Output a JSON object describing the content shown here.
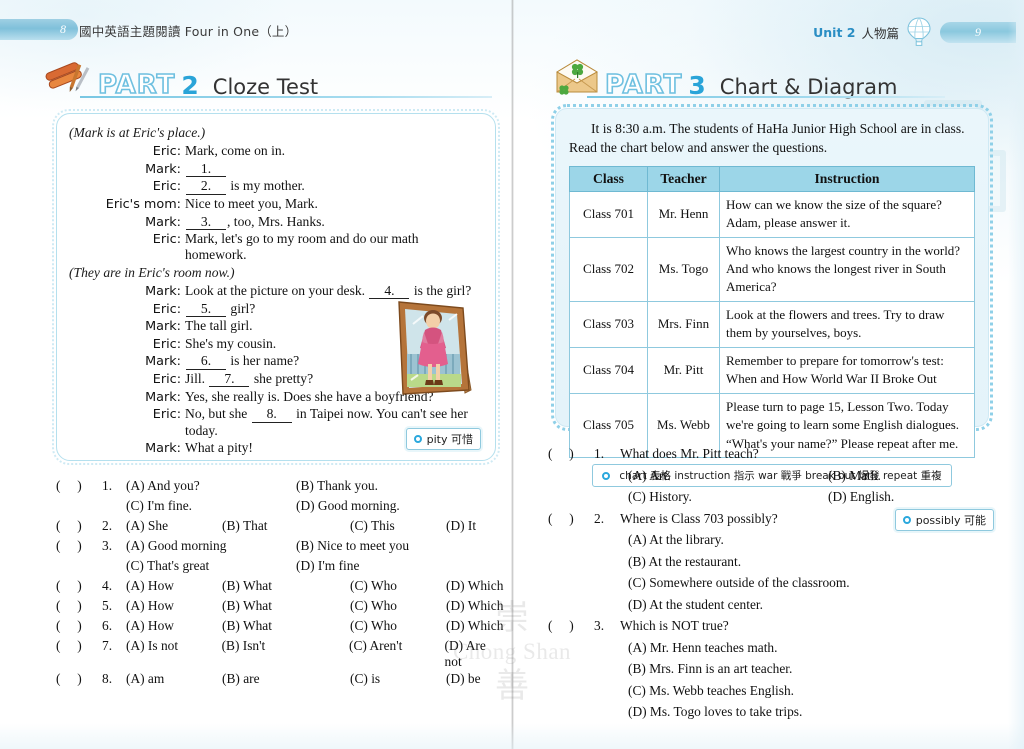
{
  "header": {
    "left_folio": "8",
    "left_title": "國中英語主題閱讀 Four in One（上）",
    "right_unit": "Unit 2",
    "right_unit_cjk": "人物篇",
    "right_folio": "9"
  },
  "part2": {
    "word": "PART",
    "number": "2",
    "title": "Cloze Test",
    "icon": "book-pencils-icon",
    "passage": {
      "stage_1": "(Mark is at Eric's place.)",
      "stage_2": "(They are in Eric's room now.)",
      "lines": [
        {
          "speaker": "Eric:",
          "before": "Mark, come on in.",
          "blank": "",
          "after": ""
        },
        {
          "speaker": "Mark:",
          "before": "",
          "blank": "1.",
          "after": ""
        },
        {
          "speaker": "Eric:",
          "before": "",
          "blank": "2.",
          "after": "is my mother."
        },
        {
          "speaker": "Eric's mom:",
          "before": "Nice to meet you, Mark.",
          "blank": "",
          "after": ""
        },
        {
          "speaker": "Mark:",
          "before": "",
          "blank": "3.",
          "after": ", too, Mrs. Hanks."
        },
        {
          "speaker": "Eric:",
          "before": "Mark, let's go to my room and do our math homework.",
          "blank": "",
          "after": ""
        },
        {
          "speaker": "Mark:",
          "before": "Look at the picture on your desk.",
          "blank": "4.",
          "after": "is the girl?"
        },
        {
          "speaker": "Eric:",
          "before": "",
          "blank": "5.",
          "after": "girl?"
        },
        {
          "speaker": "Mark:",
          "before": "The tall girl.",
          "blank": "",
          "after": ""
        },
        {
          "speaker": "Eric:",
          "before": "She's my cousin.",
          "blank": "",
          "after": ""
        },
        {
          "speaker": "Mark:",
          "before": "",
          "blank": "6.",
          "after": "is her name?"
        },
        {
          "speaker": "Eric:",
          "before": "Jill.",
          "blank": "7.",
          "after": "she pretty?"
        },
        {
          "speaker": "Mark:",
          "before": "Yes, she really is.  Does she have a boyfriend?",
          "blank": "",
          "after": ""
        },
        {
          "speaker": "Eric:",
          "before": "No, but she",
          "blank": "8.",
          "after": "in Taipei now.  You can't see her today."
        },
        {
          "speaker": "Mark:",
          "before": "What a pity!",
          "blank": "",
          "after": ""
        }
      ],
      "hint": "pity 可惜",
      "photo_alt": "framed-photo-woman-pink-dress"
    },
    "questions": [
      {
        "num": "1.",
        "layout": "two-line",
        "a": "(A) And you?",
        "b": "(B) Thank you.",
        "c": "(C) I'm fine.",
        "d": "(D) Good morning."
      },
      {
        "num": "2.",
        "layout": "one-line",
        "a": "(A) She",
        "b": "(B) That",
        "c": "(C) This",
        "d": "(D) It"
      },
      {
        "num": "3.",
        "layout": "two-line",
        "a": "(A) Good morning",
        "b": "(B) Nice to meet you",
        "c": "(C) That's great",
        "d": "(D) I'm fine"
      },
      {
        "num": "4.",
        "layout": "one-line",
        "a": "(A) How",
        "b": "(B) What",
        "c": "(C) Who",
        "d": "(D) Which"
      },
      {
        "num": "5.",
        "layout": "one-line",
        "a": "(A) How",
        "b": "(B) What",
        "c": "(C) Who",
        "d": "(D) Which"
      },
      {
        "num": "6.",
        "layout": "one-line",
        "a": "(A) How",
        "b": "(B) What",
        "c": "(C) Who",
        "d": "(D) Which"
      },
      {
        "num": "7.",
        "layout": "one-line",
        "a": "(A) Is not",
        "b": "(B) Isn't",
        "c": "(C) Aren't",
        "d": "(D) Are not"
      },
      {
        "num": "8.",
        "layout": "one-line",
        "a": "(A) am",
        "b": "(B) are",
        "c": "(C) is",
        "d": "(D) be"
      }
    ],
    "paren_open": "(",
    "paren_close": ")"
  },
  "part3": {
    "word": "PART",
    "number": "3",
    "title": "Chart & Diagram",
    "icon": "envelope-clover-icon",
    "intro_line_1": "It is 8:30 a.m.  The students of HaHa Junior High School are in class.",
    "intro_line_2": "Read the chart below and answer the questions.",
    "table": {
      "columns": [
        "Class",
        "Teacher",
        "Instruction"
      ],
      "rows": [
        {
          "class": "Class 701",
          "teacher": "Mr. Henn",
          "instruction": "How can we know the size of the square?  Adam, please answer it."
        },
        {
          "class": "Class 702",
          "teacher": "Ms. Togo",
          "instruction": "Who knows the largest country in the world?  And who knows the longest river in South America?"
        },
        {
          "class": "Class 703",
          "teacher": "Mrs. Finn",
          "instruction": "Look at the flowers and trees.  Try to draw them by yourselves, boys."
        },
        {
          "class": "Class 704",
          "teacher": "Mr. Pitt",
          "instruction": "Remember to prepare for tomorrow's test: When and How World War II Broke Out"
        },
        {
          "class": "Class 705",
          "teacher": "Ms. Webb",
          "instruction": "Please turn to page 15, Lesson Two.  Today we're going to learn some English dialogues.  “What's your name?”  Please repeat after me."
        }
      ]
    },
    "vocab": "chart 表格    instruction 指示    war 戰爭    break out 爆發    repeat 重複",
    "hint": "possibly 可能",
    "questions": [
      {
        "num": "1.",
        "stem": "What does Mr. Pitt teach?",
        "a": "(A) Art.",
        "b": "(B) Math.",
        "c": "(C) History.",
        "d": "(D) English."
      },
      {
        "num": "2.",
        "stem": "Where is Class 703 possibly?",
        "a": "(A) At the library.",
        "b": "(B) At the restaurant.",
        "c": "(C) Somewhere outside of the classroom.",
        "d": "(D) At the student center."
      },
      {
        "num": "3.",
        "stem": "Which is NOT true?",
        "a": "(A) Mr. Henn teaches math.",
        "b": "(B) Mrs. Finn is an art teacher.",
        "c": "(C) Ms. Webb teaches English.",
        "d": "(D) Ms. Togo loves to take trips."
      }
    ],
    "paren_open": "(",
    "paren_close": ")"
  },
  "watermark": {
    "cjk_top": "崇",
    "latin": "Chong Shan",
    "cjk_bottom": "善"
  },
  "colors": {
    "accent_blue": "#2aa4d8",
    "header_blue": "#2a8ec4",
    "table_header": "#9cd6e8",
    "panel_bg": "#e7f4fa",
    "rule": "#79c7e3"
  }
}
